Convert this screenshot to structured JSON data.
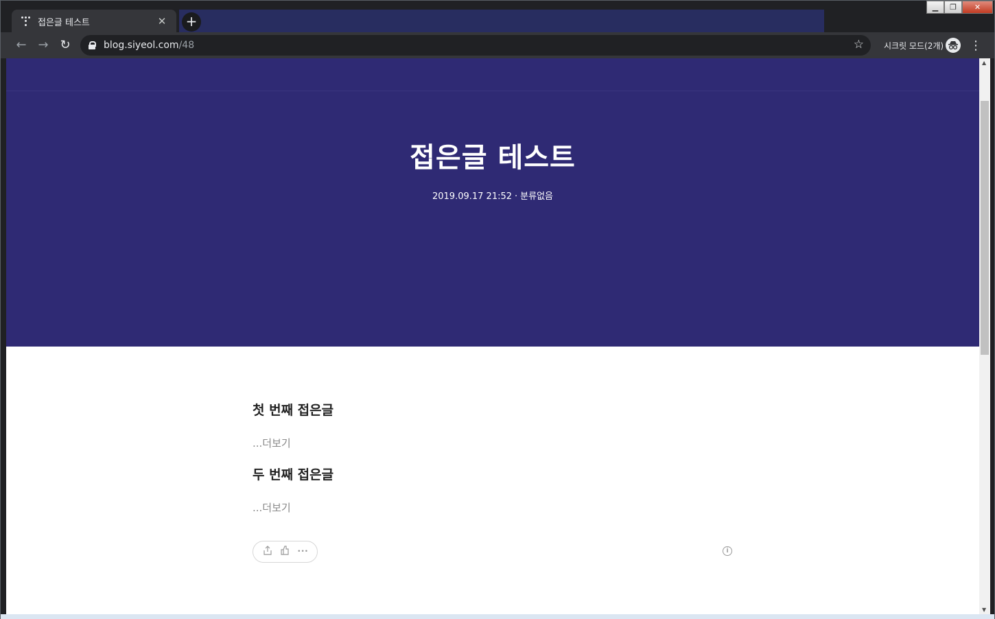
{
  "browser": {
    "tab": {
      "title": "접은글 테스트",
      "close": "✕"
    },
    "new_tab": "+",
    "window_controls": {
      "minimize": "▁",
      "maximize": "❐",
      "close": "✕"
    },
    "nav": {
      "back": "←",
      "forward": "→",
      "reload": "↻"
    },
    "url": {
      "host": "blog.siyeol.com",
      "path": "/48"
    },
    "bookmark": "☆",
    "incognito": {
      "label": "시크릿 모드(2개)",
      "icon": "◉"
    },
    "menu": "⋮"
  },
  "post": {
    "title": "접은글 테스트",
    "date": "2019.09.17 21:52",
    "separator": "·",
    "category": "분류없음",
    "folds": [
      {
        "title": "첫 번째 접은글",
        "more": "...더보기"
      },
      {
        "title": "두 번째 접은글",
        "more": "...더보기"
      }
    ],
    "actions": {
      "share": "⇪",
      "like": "👍",
      "more": "•••"
    },
    "info": "i"
  },
  "colors": {
    "hero": "#2f2a74",
    "chrome_dark": "#202124",
    "toolbar": "#35363a"
  }
}
